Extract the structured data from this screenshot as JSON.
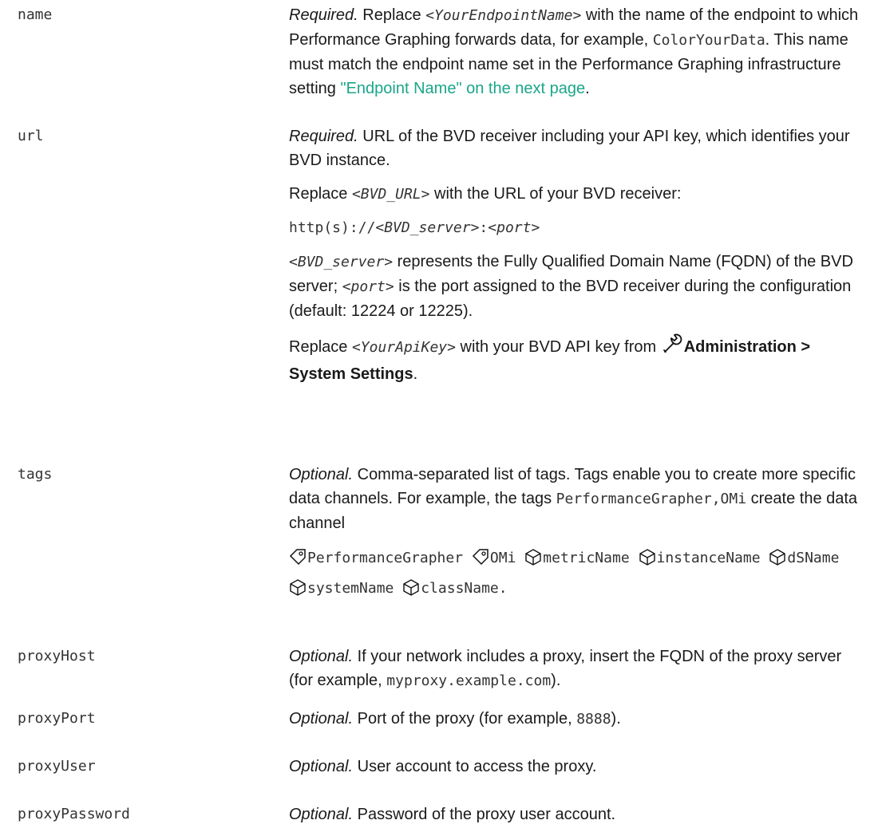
{
  "params": {
    "name": {
      "term": "name",
      "required": "Required.",
      "t1": " Replace ",
      "code1": "<YourEndpointName>",
      "t2": " with the name of the endpoint to which Performance Graphing forwards data, for example, ",
      "code2": "ColorYourData",
      "t3": ". This name must match the endpoint name set in the Performance Graphing infrastructure setting ",
      "link": "\"Endpoint Name\" on the next page",
      "t4": "."
    },
    "url": {
      "term": "url",
      "required": "Required.",
      "p1": " URL of the BVD receiver including your API key, which identifies your BVD instance.",
      "p2a": "Replace ",
      "p2code": "<BVD_URL>",
      "p2b": " with the URL of your BVD receiver:",
      "p3a": "http(s)://",
      "p3b": "<BVD_server>",
      "p3c": ":",
      "p3d": "<port>",
      "p4code": "<BVD_server>",
      "p4a": " represents the Fully Qualified Domain Name (FQDN) of the BVD server; ",
      "p4code2": "<port>",
      "p4b": " is the port assigned to the BVD receiver during the configuration (default: 12224 or 12225).",
      "p5a": "Replace ",
      "p5code": "<YourApiKey>",
      "p5b": " with your BVD API key from ",
      "p5bold": "Administration > System Settings",
      "p5c": ".",
      "wrench_icon": "wrench-icon"
    },
    "tags": {
      "term": "tags",
      "optional": "Optional.",
      "t1": " Comma-separated list of tags. Tags enable you to create more specific data channels. For example, the tags ",
      "code": "PerformanceGrapher,OMi",
      "t2": " create the data channel",
      "channel_tags": [
        "PerformanceGrapher",
        "OMi"
      ],
      "channel_dims": [
        "metricName",
        "instanceName",
        "dSName",
        "systemName",
        "className"
      ],
      "end": "."
    },
    "proxyHost": {
      "term": "proxyHost",
      "optional": "Optional.",
      "t1": " If your network includes a proxy, insert the FQDN of the proxy server (for example, ",
      "code": "myproxy.example.com",
      "t2": ")."
    },
    "proxyPort": {
      "term": "proxyPort",
      "optional": "Optional.",
      "t1": " Port of the proxy (for example, ",
      "code": "8888",
      "t2": ")."
    },
    "proxyUser": {
      "term": "proxyUser",
      "optional": "Optional.",
      "t1": " User account to access the proxy."
    },
    "proxyPassword": {
      "term": "proxyPassword",
      "optional": "Optional.",
      "t1": " Password of the proxy user account."
    }
  },
  "colors": {
    "link": "#1aa68a",
    "text": "#1a1a1a",
    "code": "#333333"
  }
}
